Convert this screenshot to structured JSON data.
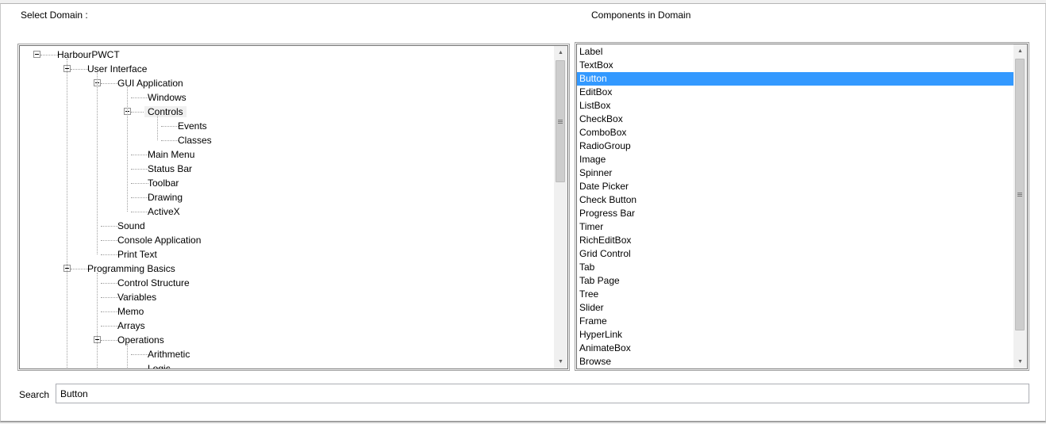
{
  "labels": {
    "select_domain": "Select Domain :",
    "components_in_domain": "Components in Domain",
    "search": "Search"
  },
  "tree": {
    "nodes": [
      {
        "label": "HarbourPWCT",
        "level": 0,
        "expander": "collapse"
      },
      {
        "label": "User Interface",
        "level": 1,
        "expander": "collapse"
      },
      {
        "label": "GUI Application",
        "level": 2,
        "expander": "collapse"
      },
      {
        "label": "Windows",
        "level": 3
      },
      {
        "label": "Controls",
        "level": 3,
        "expander": "collapse",
        "selected": true
      },
      {
        "label": "Events",
        "level": 4
      },
      {
        "label": "Classes",
        "level": 4
      },
      {
        "label": "Main Menu",
        "level": 3
      },
      {
        "label": "Status Bar",
        "level": 3
      },
      {
        "label": "Toolbar",
        "level": 3
      },
      {
        "label": "Drawing",
        "level": 3
      },
      {
        "label": "ActiveX",
        "level": 3
      },
      {
        "label": "Sound",
        "level": 2
      },
      {
        "label": "Console Application",
        "level": 2
      },
      {
        "label": "Print Text",
        "level": 2
      },
      {
        "label": "Programming Basics",
        "level": 1,
        "expander": "collapse"
      },
      {
        "label": "Control Structure",
        "level": 2
      },
      {
        "label": "Variables",
        "level": 2
      },
      {
        "label": "Memo",
        "level": 2
      },
      {
        "label": "Arrays",
        "level": 2
      },
      {
        "label": "Operations",
        "level": 2,
        "expander": "collapse"
      },
      {
        "label": "Arithmetic",
        "level": 3
      },
      {
        "label": "Logic",
        "level": 3
      }
    ]
  },
  "components": {
    "items": [
      "Label",
      "TextBox",
      "Button",
      "EditBox",
      "ListBox",
      "CheckBox",
      "ComboBox",
      "RadioGroup",
      "Image",
      "Spinner",
      "Date Picker",
      "Check Button",
      "Progress Bar",
      "Timer",
      "RichEditBox",
      "Grid Control",
      "Tab",
      "Tab Page",
      "Tree",
      "Slider",
      "Frame",
      "HyperLink",
      "AnimateBox",
      "Browse"
    ],
    "selected": "Button"
  },
  "search": {
    "value": "Button"
  },
  "colors": {
    "selection": "#3399ff",
    "tree_selected_bg": "#f0f0f0"
  },
  "icons": {
    "expander": "collapse-minus-icon",
    "scroll_up": "scroll-up-arrow-icon",
    "scroll_down": "scroll-down-arrow-icon",
    "scroll_grip": "scroll-grip-icon"
  }
}
